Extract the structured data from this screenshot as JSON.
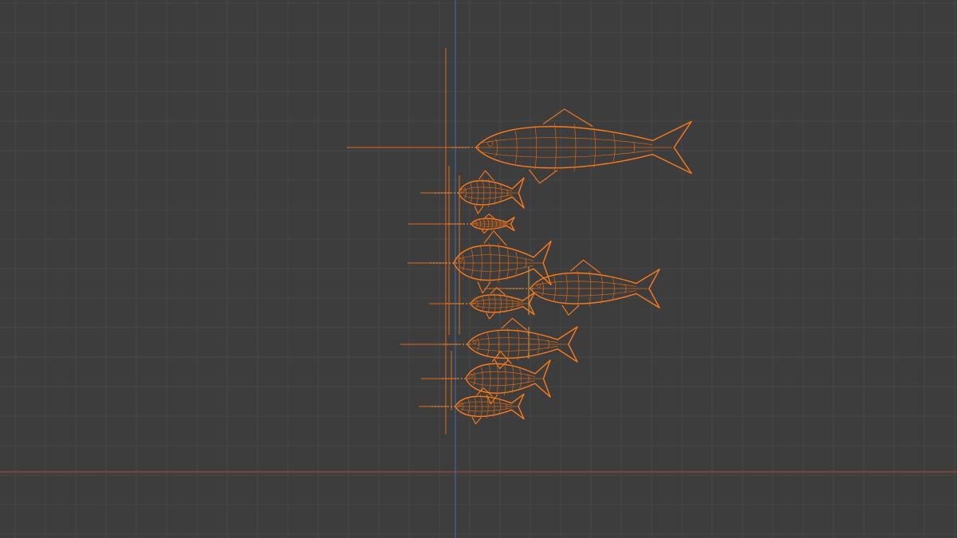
{
  "viewport": {
    "background": "#3d3d3d",
    "grid_color": "#474747",
    "x_axis_color": "#c24a4a",
    "y_axis_color": "#3f72b5",
    "selection_color": "#ff7a1a"
  },
  "objects": [
    {
      "id": "fish-1",
      "icon": "fish-wireframe-icon"
    },
    {
      "id": "fish-2",
      "icon": "fish-wireframe-icon"
    },
    {
      "id": "fish-3",
      "icon": "fish-wireframe-icon"
    },
    {
      "id": "fish-4",
      "icon": "fish-wireframe-icon"
    },
    {
      "id": "fish-5",
      "icon": "fish-wireframe-icon"
    },
    {
      "id": "fish-6",
      "icon": "fish-wireframe-icon"
    },
    {
      "id": "fish-7",
      "icon": "fish-wireframe-icon"
    },
    {
      "id": "fish-8",
      "icon": "fish-wireframe-icon"
    },
    {
      "id": "fish-9",
      "icon": "fish-wireframe-icon"
    }
  ]
}
